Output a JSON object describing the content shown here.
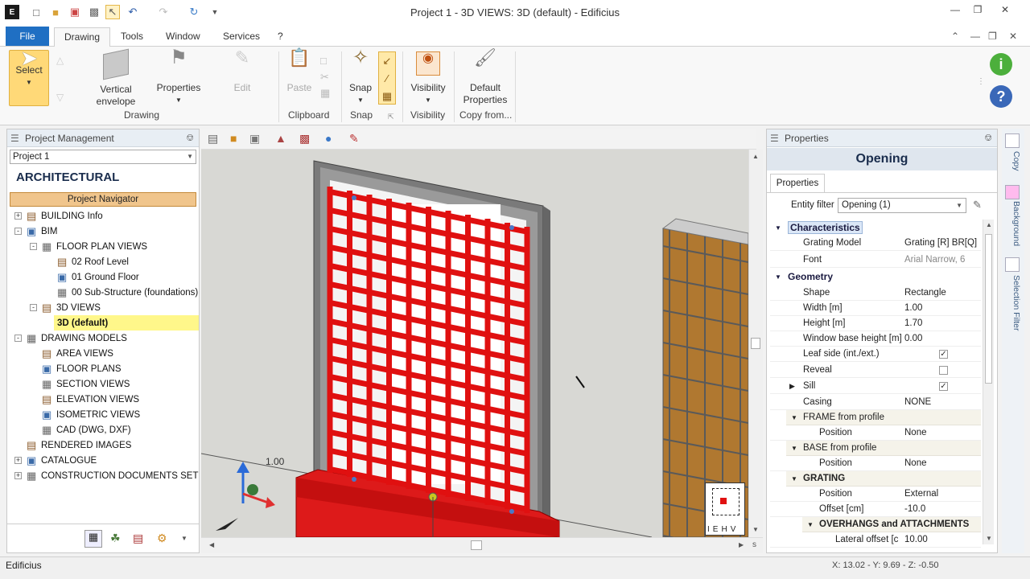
{
  "window": {
    "title": "Project 1 - 3D VIEWS: 3D (default) - Edificius"
  },
  "menu": {
    "file": "File",
    "tabs": [
      "Drawing",
      "Tools",
      "Window",
      "Services",
      "?"
    ]
  },
  "ribbon": {
    "select": "Select",
    "vertical_envelope": "Vertical envelope",
    "properties": "Properties",
    "edit": "Edit",
    "paste": "Paste",
    "snap": "Snap",
    "visibility": "Visibility",
    "default_properties": "Default Properties",
    "groups": [
      "Drawing",
      "Clipboard",
      "Snap",
      "Visibility",
      "Copy from..."
    ]
  },
  "project_panel": {
    "title": "Project Management",
    "project_select": "Project 1",
    "heading": "ARCHITECTURAL",
    "navigator": "Project Navigator",
    "tree": [
      {
        "label": "BUILDING Info",
        "level": 0,
        "exp": "+"
      },
      {
        "label": "BIM",
        "level": 0,
        "exp": "-"
      },
      {
        "label": "FLOOR PLAN VIEWS",
        "level": 1,
        "exp": "-"
      },
      {
        "label": "02 Roof Level",
        "level": 2,
        "exp": ""
      },
      {
        "label": "01 Ground Floor",
        "level": 2,
        "exp": ""
      },
      {
        "label": "00 Sub-Structure (foundations)",
        "level": 2,
        "exp": ""
      },
      {
        "label": "3D VIEWS",
        "level": 1,
        "exp": "-"
      },
      {
        "label": "3D (default)",
        "level": 2,
        "exp": "",
        "selected": true
      },
      {
        "label": "DRAWING MODELS",
        "level": 0,
        "exp": "-"
      },
      {
        "label": "AREA VIEWS",
        "level": 1,
        "exp": ""
      },
      {
        "label": "FLOOR PLANS",
        "level": 1,
        "exp": ""
      },
      {
        "label": "SECTION VIEWS",
        "level": 1,
        "exp": ""
      },
      {
        "label": "ELEVATION VIEWS",
        "level": 1,
        "exp": ""
      },
      {
        "label": "ISOMETRIC VIEWS",
        "level": 1,
        "exp": ""
      },
      {
        "label": "CAD (DWG, DXF)",
        "level": 1,
        "exp": ""
      },
      {
        "label": "RENDERED IMAGES",
        "level": 0,
        "exp": ""
      },
      {
        "label": "CATALOGUE",
        "level": 0,
        "exp": "+"
      },
      {
        "label": "CONSTRUCTION DOCUMENTS SET",
        "level": 0,
        "exp": "+"
      }
    ]
  },
  "viewport": {
    "dimension_label": "1.00",
    "nav_cube_letters": [
      "I",
      "E",
      "H",
      "V"
    ]
  },
  "properties_panel": {
    "title": "Properties",
    "object_name": "Opening",
    "tab": "Properties",
    "entity_filter_label": "Entity filter",
    "entity_filter_value": "Opening (1)",
    "sections": {
      "characteristics": "Characteristics",
      "geometry": "Geometry",
      "frame": "FRAME from profile",
      "base": "BASE from profile",
      "grating": "GRATING",
      "overhangs": "OVERHANGS and ATTACHMENTS"
    },
    "rows": {
      "grating_model": {
        "k": "Grating Model",
        "v": "Grating [R] BR[Q] I"
      },
      "font": {
        "k": "Font",
        "v": "Arial Narrow, 6"
      },
      "shape": {
        "k": "Shape",
        "v": "Rectangle"
      },
      "width": {
        "k": "Width  [m]",
        "v": "1.00"
      },
      "height": {
        "k": "Height  [m]",
        "v": "1.70"
      },
      "base_height": {
        "k": "Window base height  [m]",
        "v": "0.00"
      },
      "leaf_side": {
        "k": "Leaf side (int./ext.)",
        "checked": true
      },
      "reveal": {
        "k": "Reveal",
        "checked": false
      },
      "sill": {
        "k": "Sill",
        "checked": true
      },
      "casing": {
        "k": "Casing",
        "v": "NONE"
      },
      "frame_position": {
        "k": "Position",
        "v": "None"
      },
      "base_position": {
        "k": "Position",
        "v": "None"
      },
      "grating_position": {
        "k": "Position",
        "v": "External"
      },
      "offset": {
        "k": "Offset  [cm]",
        "v": "-10.0"
      },
      "lateral_offset": {
        "k": "Lateral offset  [c",
        "v": "10.00"
      }
    }
  },
  "side_tabs": [
    "Copy",
    "Background",
    "Selection Filter"
  ],
  "status": {
    "left": "Edificius",
    "coords": "X: 13.02 - Y: 9.69 - Z: -0.50"
  }
}
